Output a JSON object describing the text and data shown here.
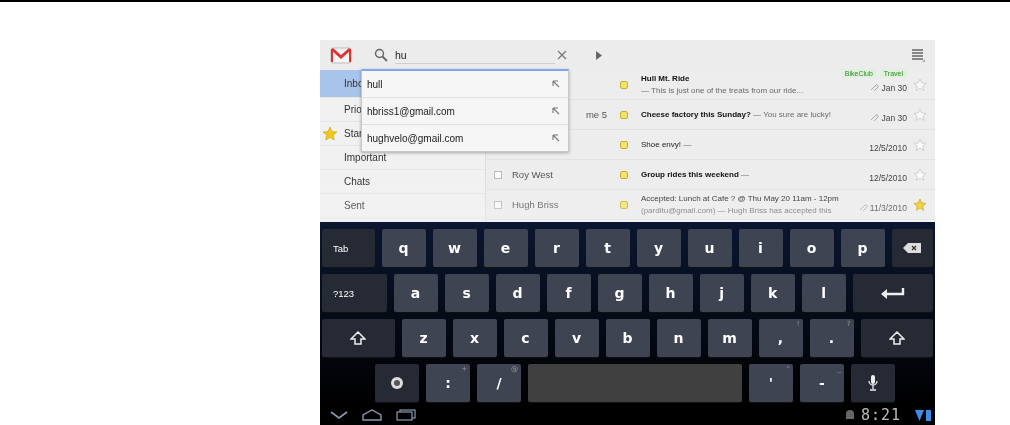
{
  "search": {
    "value": "hu"
  },
  "suggestions": [
    {
      "text": "hull"
    },
    {
      "text": "hbriss1@gmail.com"
    },
    {
      "text": "hughvelo@gmail.com"
    }
  ],
  "sidebar": {
    "items": [
      {
        "label": "Inbo",
        "selected": true,
        "kind": "plain"
      },
      {
        "label": "Prio",
        "selected": false,
        "kind": "plain"
      },
      {
        "label": "Star",
        "selected": false,
        "kind": "starred"
      },
      {
        "label": "Important",
        "selected": false,
        "kind": "plain"
      },
      {
        "label": "Chats",
        "selected": false,
        "kind": "plain"
      },
      {
        "label": "Sent",
        "selected": false,
        "kind": "plain"
      }
    ]
  },
  "emails": [
    {
      "subject": "Hull Mt. Ride",
      "snippet": "— This is just one of the treats from our ride...",
      "date": "Jan 30",
      "attachment": true,
      "starred": false,
      "unread": true,
      "labels": [
        "BikeClub",
        "Travel"
      ]
    },
    {
      "sender": "me 5",
      "subject": "Cheese factory this Sunday?",
      "snippet": "— You sure are lucky!",
      "date": "Jan 30",
      "attachment": true,
      "starred": false,
      "unread": true
    },
    {
      "subject": "Shoe envy!",
      "snippet": "—",
      "date": "12/5/2010",
      "attachment": false,
      "starred": false,
      "unread": false
    },
    {
      "sender": "Roy West",
      "checked": false,
      "subject": "Group rides this weekend",
      "snippet": "—",
      "date": "12/5/2010",
      "attachment": false,
      "starred": false,
      "unread": true
    },
    {
      "sender": "Hugh Briss",
      "checked": false,
      "subject": "Accepted: Lunch at Cafe ? @ Thu May 20 11am - 12pm",
      "snippet": "(parditu@gmail.com) — Hugh Briss has accepted this",
      "date": "11/3/2010",
      "attachment": true,
      "starred": true,
      "unread": false
    }
  ],
  "keyboard": {
    "rows": [
      [
        {
          "kind": "mod",
          "label": "Tab"
        },
        {
          "kind": "text",
          "label": "q"
        },
        {
          "kind": "text",
          "label": "w"
        },
        {
          "kind": "text",
          "label": "e"
        },
        {
          "kind": "text",
          "label": "r"
        },
        {
          "kind": "text",
          "label": "t"
        },
        {
          "kind": "text",
          "label": "y"
        },
        {
          "kind": "text",
          "label": "u"
        },
        {
          "kind": "text",
          "label": "i"
        },
        {
          "kind": "text",
          "label": "o"
        },
        {
          "kind": "text",
          "label": "p"
        },
        {
          "kind": "backspace"
        }
      ],
      [
        {
          "kind": "mod",
          "label": "?123"
        },
        {
          "kind": "text",
          "label": "a"
        },
        {
          "kind": "text",
          "label": "s"
        },
        {
          "kind": "text",
          "label": "d"
        },
        {
          "kind": "text",
          "label": "f"
        },
        {
          "kind": "text",
          "label": "g"
        },
        {
          "kind": "text",
          "label": "h"
        },
        {
          "kind": "text",
          "label": "j"
        },
        {
          "kind": "text",
          "label": "k"
        },
        {
          "kind": "text",
          "label": "l"
        },
        {
          "kind": "enter"
        }
      ],
      [
        {
          "kind": "shift"
        },
        {
          "kind": "text",
          "label": "z"
        },
        {
          "kind": "text",
          "label": "x"
        },
        {
          "kind": "text",
          "label": "c"
        },
        {
          "kind": "text",
          "label": "v"
        },
        {
          "kind": "text",
          "label": "b"
        },
        {
          "kind": "text",
          "label": "n"
        },
        {
          "kind": "text",
          "label": "m"
        },
        {
          "kind": "text",
          "label": ",",
          "hint": "!"
        },
        {
          "kind": "text",
          "label": ".",
          "hint": "?"
        },
        {
          "kind": "shift"
        }
      ],
      [
        {
          "kind": "settings"
        },
        {
          "kind": "text",
          "label": ":",
          "hint": "+"
        },
        {
          "kind": "text",
          "label": "/",
          "hint": "@"
        },
        {
          "kind": "space"
        },
        {
          "kind": "text",
          "label": "'",
          "hint": "\""
        },
        {
          "kind": "text",
          "label": "-",
          "hint": "_"
        },
        {
          "kind": "mic"
        }
      ]
    ]
  },
  "status_bar": {
    "time": "8:21"
  }
}
